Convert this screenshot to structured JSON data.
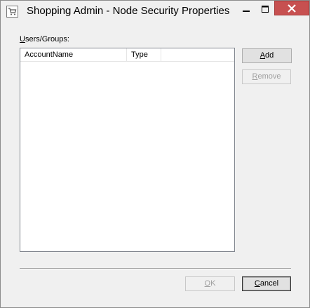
{
  "window": {
    "title": "Shopping Admin - Node Security Properties",
    "icon": "shopping-cart-icon",
    "caption_buttons": [
      "minimize-icon",
      "maximize-icon",
      "close-icon"
    ],
    "colors": {
      "close_button": "#c75050",
      "window_bg": "#f0f0f0"
    }
  },
  "users": {
    "label_accel": "U",
    "label_rest": "sers/Groups:",
    "columns": [
      "AccountName",
      "Type"
    ],
    "rows": []
  },
  "buttons": {
    "add": {
      "accel": "A",
      "rest": "dd",
      "enabled": true
    },
    "remove": {
      "accel": "R",
      "rest": "emove",
      "enabled": false
    },
    "ok": {
      "accel": "O",
      "rest": "K",
      "enabled": false
    },
    "cancel": {
      "accel": "C",
      "rest": "ancel",
      "enabled": true
    }
  }
}
